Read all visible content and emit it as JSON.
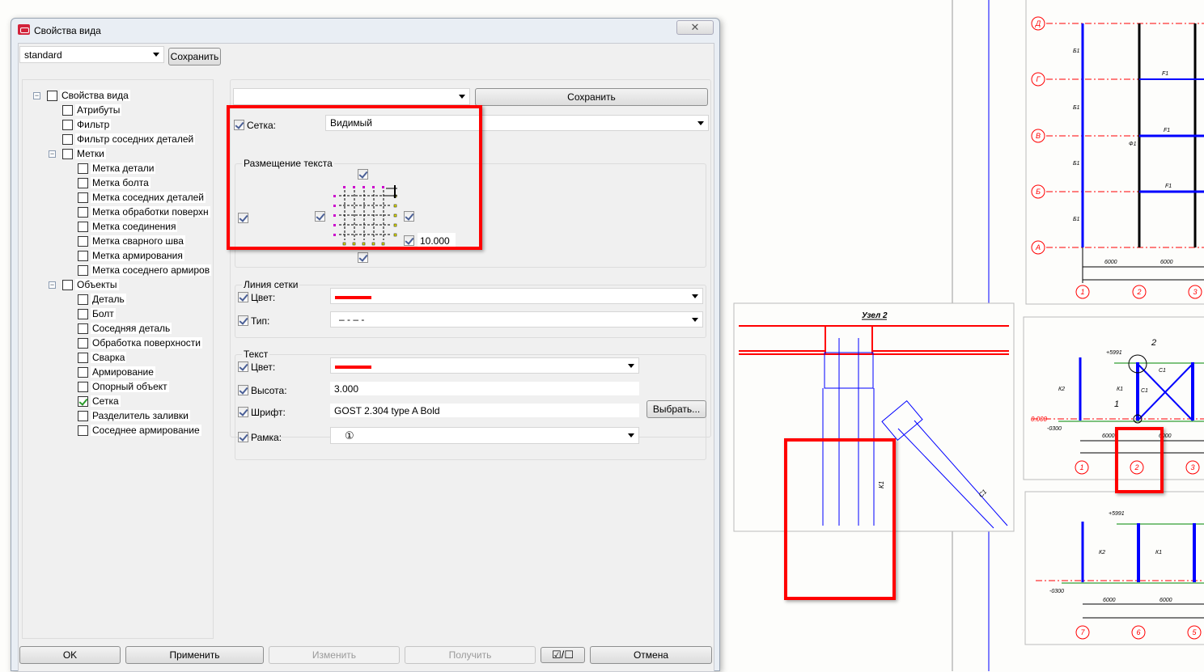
{
  "dialog": {
    "title": "Свойства вида",
    "close": "✕",
    "preset": "standard",
    "save": "Сохранить"
  },
  "tree": [
    {
      "label": "Свойства вида",
      "level": 0,
      "exp": "−",
      "checked": false
    },
    {
      "label": "Атрибуты",
      "level": 1,
      "checked": false
    },
    {
      "label": "Фильтр",
      "level": 1,
      "checked": false
    },
    {
      "label": "Фильтр соседних деталей",
      "level": 1,
      "checked": false
    },
    {
      "label": "Метки",
      "level": 1,
      "exp": "−",
      "checked": false
    },
    {
      "label": "Метка детали",
      "level": 2,
      "checked": false
    },
    {
      "label": "Метка болта",
      "level": 2,
      "checked": false
    },
    {
      "label": "Метка соседних деталей",
      "level": 2,
      "checked": false
    },
    {
      "label": "Метка обработки поверхн",
      "level": 2,
      "checked": false
    },
    {
      "label": "Метка соединения",
      "level": 2,
      "checked": false
    },
    {
      "label": "Метка сварного шва",
      "level": 2,
      "checked": false
    },
    {
      "label": "Метка армирования",
      "level": 2,
      "checked": false
    },
    {
      "label": "Метка соседнего армиров",
      "level": 2,
      "checked": false
    },
    {
      "label": "Объекты",
      "level": 1,
      "exp": "−",
      "checked": false
    },
    {
      "label": "Деталь",
      "level": 2,
      "checked": false
    },
    {
      "label": "Болт",
      "level": 2,
      "checked": false
    },
    {
      "label": "Соседняя деталь",
      "level": 2,
      "checked": false
    },
    {
      "label": "Обработка поверхности",
      "level": 2,
      "checked": false
    },
    {
      "label": "Сварка",
      "level": 2,
      "checked": false
    },
    {
      "label": "Армирование",
      "level": 2,
      "checked": false
    },
    {
      "label": "Опорный объект",
      "level": 2,
      "checked": false
    },
    {
      "label": "Сетка",
      "level": 2,
      "checked": true
    },
    {
      "label": "Разделитель заливки",
      "level": 2,
      "checked": false
    },
    {
      "label": "Соседнее армирование",
      "level": 2,
      "checked": false
    }
  ],
  "panel": {
    "top_combo": "",
    "save": "Сохранить",
    "grid_label": "Сетка:",
    "grid_value": "Видимый",
    "placement_title": "Размещение текста",
    "offset": "10.000",
    "line_title": "Линия сетки",
    "line_color_label": "Цвет:",
    "line_color": "#ff0000",
    "line_type_label": "Тип:",
    "line_type": "– - – -",
    "text_title": "Текст",
    "text_color_label": "Цвет:",
    "text_color": "#ff0000",
    "height_label": "Высота:",
    "height": "3.000",
    "font_label": "Шрифт:",
    "font": "GOST 2.304 type A Bold",
    "choose": "Выбрать...",
    "frame_label": "Рамка:",
    "frame": "①"
  },
  "buttons": {
    "ok": "OK",
    "apply": "Применить",
    "modify": "Изменить",
    "get": "Получить",
    "toggle": "☑/☐",
    "cancel": "Отмена"
  },
  "drawing": {
    "detail_title": "Узел 2",
    "axes_rows": [
      "Д",
      "Г",
      "В",
      "Б",
      "А"
    ],
    "axes_cols_top": [
      "1",
      "2",
      "3"
    ],
    "axes_cols_mid": [
      "1",
      "2",
      "3"
    ],
    "axes_cols_bot": [
      "7",
      "6",
      "5"
    ],
    "dim": "6000",
    "labels": {
      "b1": "Б1",
      "f1": "F1",
      "fi1": "Ф1",
      "k1": "К1",
      "k2": "К2",
      "c1": "С1",
      "elev_top": "+5991",
      "elev_base": "0.000",
      "elev_low": "-0300",
      "node1": "1",
      "node2": "2"
    }
  },
  "colors": {
    "grid_red": "#ff0000",
    "steel_blue": "#0000ff",
    "highlight": "#ff0000"
  }
}
